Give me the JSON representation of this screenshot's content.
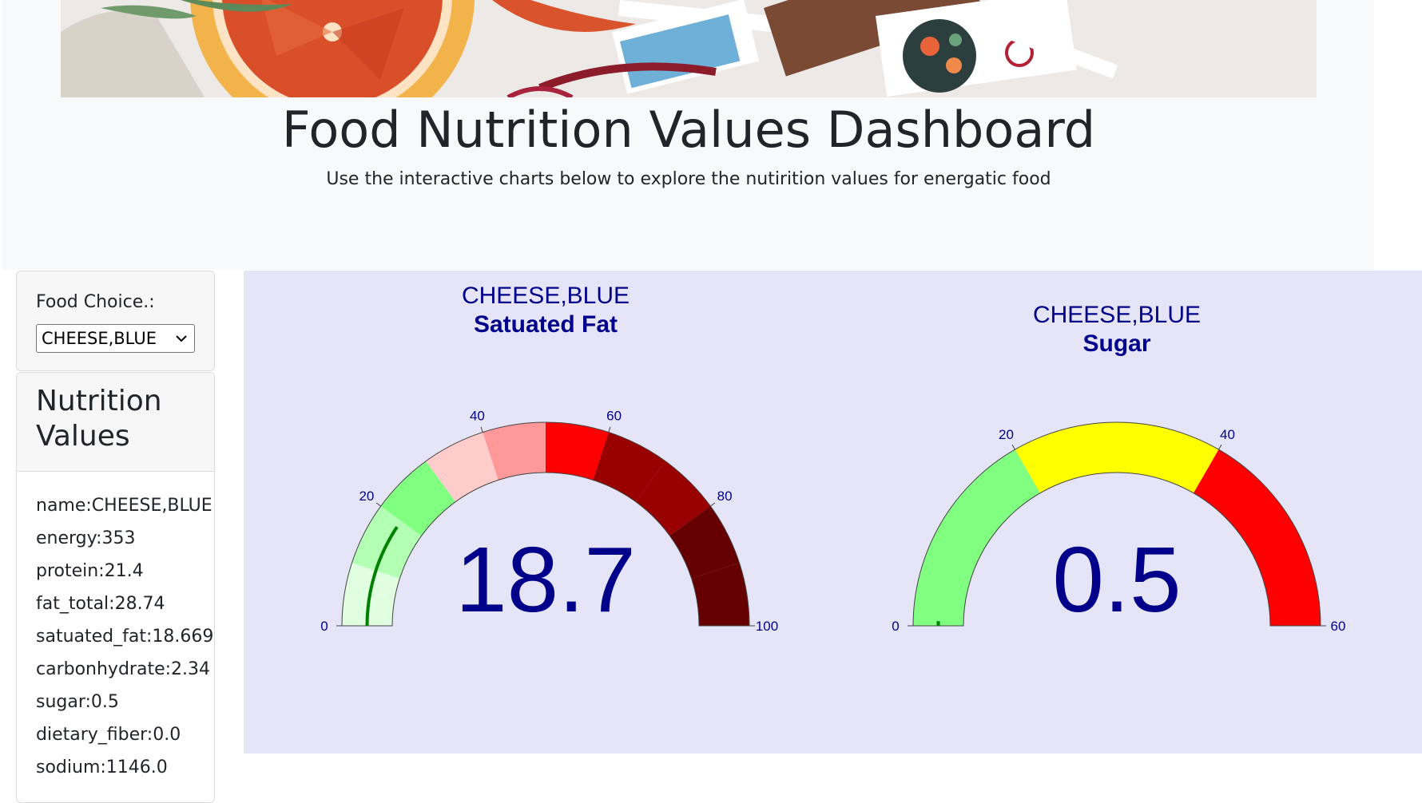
{
  "header": {
    "title": "Food Nutrition Values Dashboard",
    "subtitle": "Use the interactive charts below to explore the nutirition values for energatic food"
  },
  "sidebar": {
    "food_choice_label": "Food Choice.:",
    "selected_food": "CHEESE,BLUE",
    "nutrition_title": "Nutrition Values",
    "nutrition_items": [
      "name:CHEESE,BLUE",
      "energy:353",
      "protein:21.4",
      "fat_total:28.74",
      "satuated_fat:18.669",
      "carbonhydrate:2.34",
      "sugar:0.5",
      "dietary_fiber:0.0",
      "sodium:1146.0"
    ]
  },
  "colors": {
    "number": "#00008b",
    "panel_background": "#e5e5f7",
    "bar": "#008000"
  },
  "chart_data": [
    {
      "type": "gauge",
      "title_line1": "CHEESE,BLUE",
      "title_line2": "Satuated Fat",
      "value": 18.7,
      "range": [
        0,
        100
      ],
      "ticks": [
        0,
        20,
        40,
        60,
        80,
        100
      ],
      "bands": [
        {
          "from": 0,
          "to": 10,
          "color": "#e0ffe0"
        },
        {
          "from": 10,
          "to": 20,
          "color": "#b3ffb3"
        },
        {
          "from": 20,
          "to": 30,
          "color": "#80ff80"
        },
        {
          "from": 30,
          "to": 40,
          "color": "#ffcccc"
        },
        {
          "from": 40,
          "to": 50,
          "color": "#ff9999"
        },
        {
          "from": 50,
          "to": 60,
          "color": "#ff0000"
        },
        {
          "from": 60,
          "to": 70,
          "color": "#990000"
        },
        {
          "from": 70,
          "to": 80,
          "color": "#990000"
        },
        {
          "from": 80,
          "to": 90,
          "color": "#660000"
        },
        {
          "from": 90,
          "to": 100,
          "color": "#660000"
        }
      ]
    },
    {
      "type": "gauge",
      "title_line1": "CHEESE,BLUE",
      "title_line2": "Sugar",
      "value": 0.5,
      "range": [
        0,
        60
      ],
      "ticks": [
        0,
        20,
        40,
        60
      ],
      "bands": [
        {
          "from": 0,
          "to": 20,
          "color": "#80ff80"
        },
        {
          "from": 20,
          "to": 40,
          "color": "#ffff00"
        },
        {
          "from": 40,
          "to": 60,
          "color": "#ff0000"
        }
      ]
    }
  ]
}
